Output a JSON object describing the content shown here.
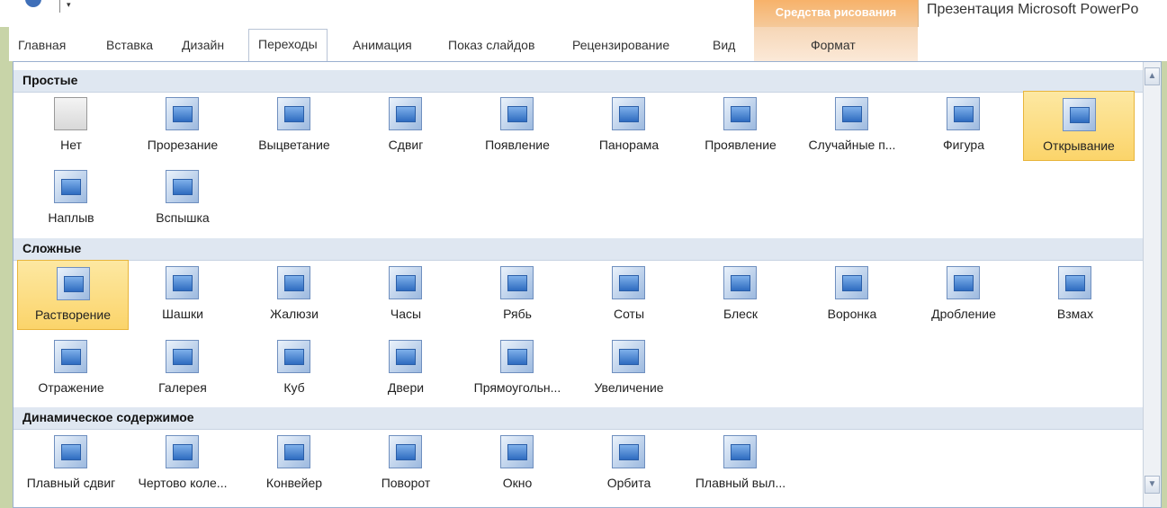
{
  "window": {
    "context_header": "Средства рисования",
    "doc_title": "Презентация Microsoft PowerPo"
  },
  "ribbon": {
    "tabs": [
      {
        "label": "Главная"
      },
      {
        "label": "Вставка"
      },
      {
        "label": "Дизайн"
      },
      {
        "label": "Переходы",
        "active": true
      },
      {
        "label": "Анимация"
      },
      {
        "label": "Показ слайдов"
      },
      {
        "label": "Рецензирование"
      },
      {
        "label": "Вид"
      },
      {
        "label": "Формат"
      }
    ]
  },
  "gallery": {
    "sections": [
      {
        "title": "Простые",
        "items": [
          {
            "label": "Нет",
            "icon": "none-icon"
          },
          {
            "label": "Прорезание",
            "icon": "cut-icon"
          },
          {
            "label": "Выцветание",
            "icon": "fade-icon"
          },
          {
            "label": "Сдвиг",
            "icon": "push-icon"
          },
          {
            "label": "Появление",
            "icon": "wipe-icon"
          },
          {
            "label": "Панорама",
            "icon": "split-icon"
          },
          {
            "label": "Проявление",
            "icon": "reveal-icon"
          },
          {
            "label": "Случайные п...",
            "icon": "random-bars-icon"
          },
          {
            "label": "Фигура",
            "icon": "shape-icon"
          },
          {
            "label": "Открывание",
            "icon": "uncover-icon",
            "selected": true
          },
          {
            "label": "Наплыв",
            "icon": "cover-icon"
          },
          {
            "label": "Вспышка",
            "icon": "flash-icon"
          }
        ]
      },
      {
        "title": "Сложные",
        "items": [
          {
            "label": "Растворение",
            "icon": "dissolve-icon",
            "selected": true
          },
          {
            "label": "Шашки",
            "icon": "checkerboard-icon"
          },
          {
            "label": "Жалюзи",
            "icon": "blinds-icon"
          },
          {
            "label": "Часы",
            "icon": "clock-icon"
          },
          {
            "label": "Рябь",
            "icon": "ripple-icon"
          },
          {
            "label": "Соты",
            "icon": "honeycomb-icon"
          },
          {
            "label": "Блеск",
            "icon": "glitter-icon"
          },
          {
            "label": "Воронка",
            "icon": "vortex-icon"
          },
          {
            "label": "Дробление",
            "icon": "shred-icon"
          },
          {
            "label": "Взмах",
            "icon": "switch-icon"
          },
          {
            "label": "Отражение",
            "icon": "flip-icon"
          },
          {
            "label": "Галерея",
            "icon": "gallery-icon"
          },
          {
            "label": "Куб",
            "icon": "cube-icon"
          },
          {
            "label": "Двери",
            "icon": "doors-icon"
          },
          {
            "label": "Прямоугольн...",
            "icon": "box-icon"
          },
          {
            "label": "Увеличение",
            "icon": "zoom-icon"
          }
        ]
      },
      {
        "title": "Динамическое содержимое",
        "items": [
          {
            "label": "Плавный сдвиг",
            "icon": "pan-icon"
          },
          {
            "label": "Чертово коле...",
            "icon": "ferris-wheel-icon"
          },
          {
            "label": "Конвейер",
            "icon": "conveyor-icon"
          },
          {
            "label": "Поворот",
            "icon": "rotate-icon"
          },
          {
            "label": "Окно",
            "icon": "window-icon"
          },
          {
            "label": "Орбита",
            "icon": "orbit-icon"
          },
          {
            "label": "Плавный выл...",
            "icon": "fly-through-icon"
          }
        ]
      }
    ]
  },
  "scrollbar": {
    "up": "▲",
    "down": "▼"
  }
}
